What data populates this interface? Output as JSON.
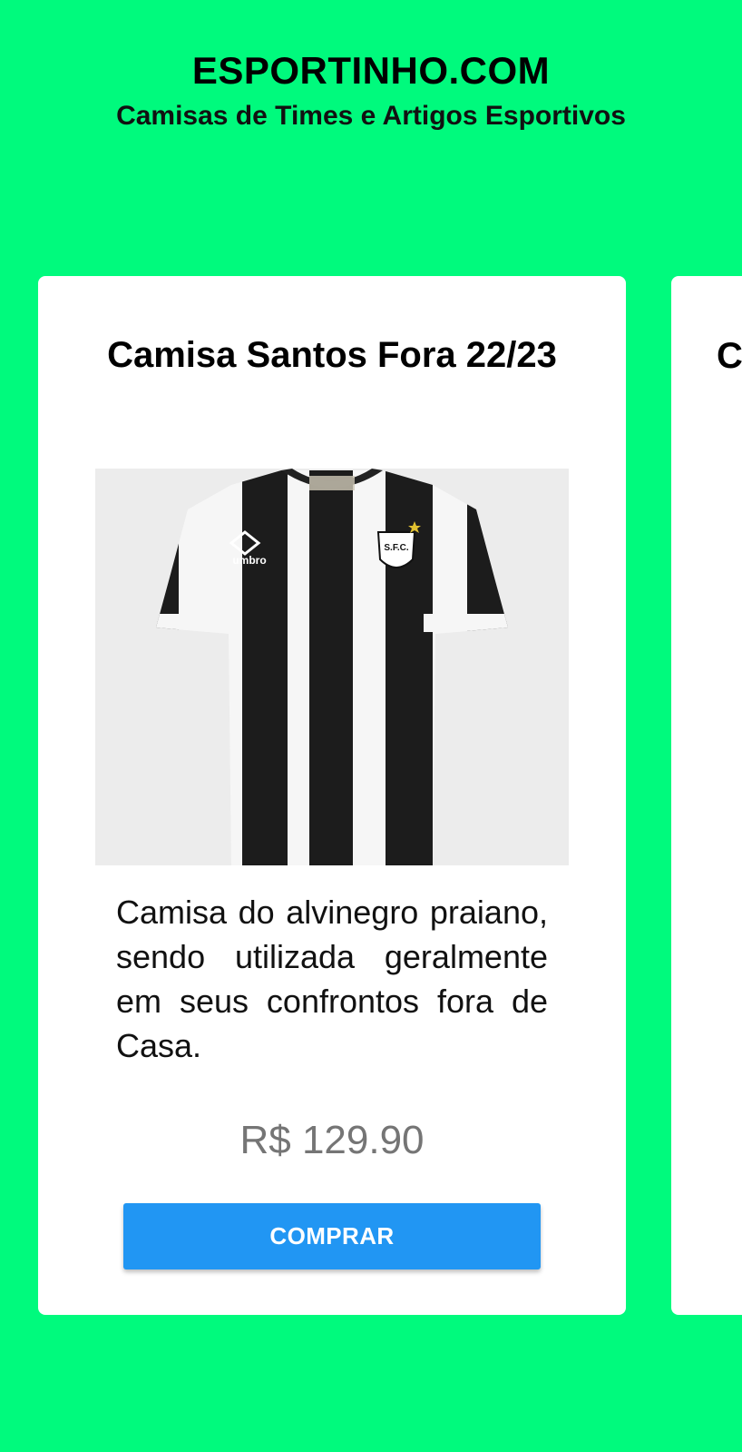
{
  "header": {
    "title": "ESPORTINHO.COM",
    "subtitle": "Camisas de Times e Artigos Esportivos"
  },
  "products": [
    {
      "name": "Camisa Santos Fora 22/23",
      "description": "Camisa do alvinegro praiano, sendo utilizada geralmente em seus confrontos fora de Casa.",
      "price": "R$ 129.90",
      "button_label": "COMPRAR",
      "image": {
        "brand_text": "umbro",
        "crest_text": "S.F.C.",
        "stripe_colors": [
          "#1c1c1c",
          "#f6f6f6"
        ]
      }
    },
    {
      "name_visible": "C"
    }
  ],
  "colors": {
    "background": "#00FA7D",
    "card": "#FFFFFF",
    "button": "#2196F3",
    "price": "#757575"
  }
}
